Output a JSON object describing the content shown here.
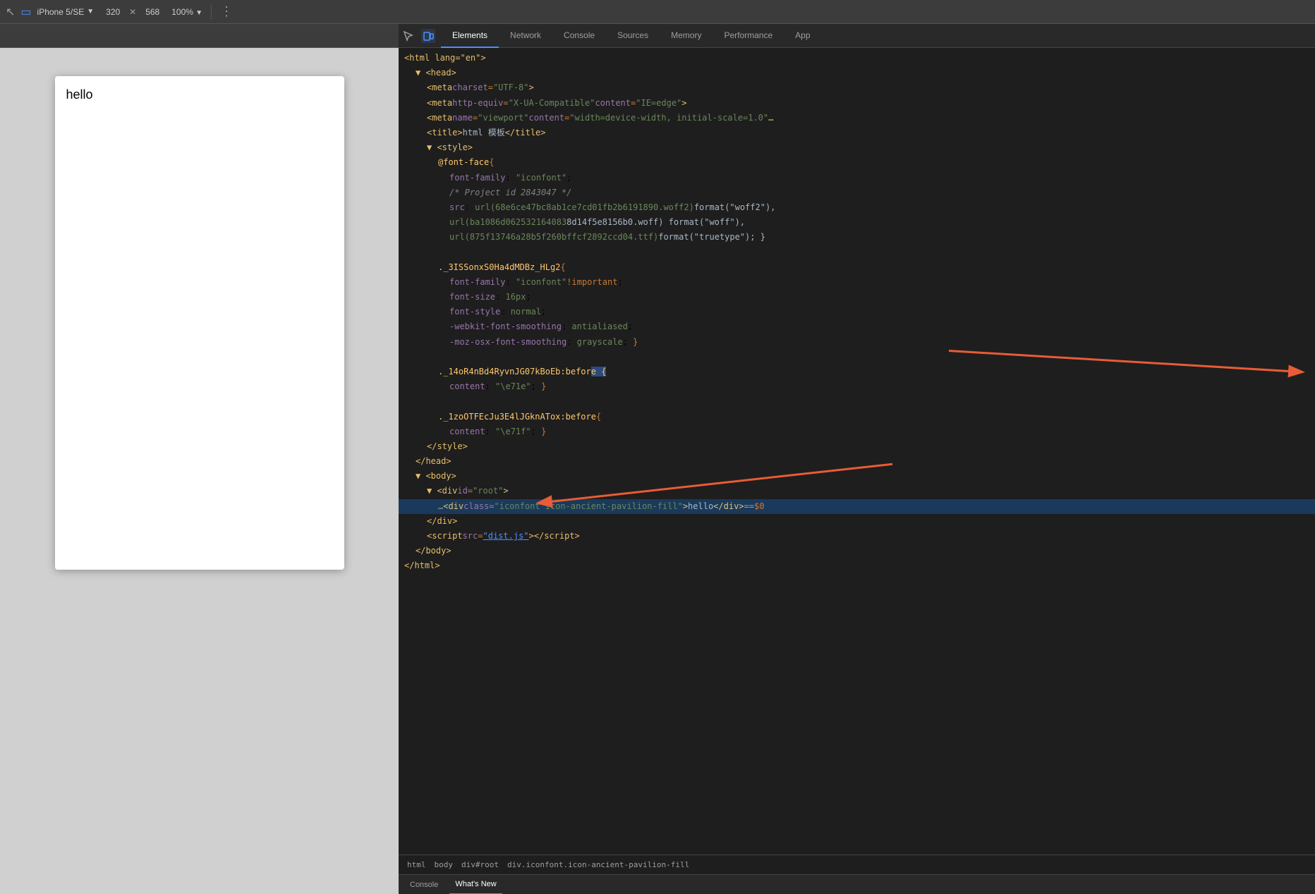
{
  "toolbar": {
    "device_label": "iPhone 5/SE",
    "width": "320",
    "close_symbol": "✕",
    "height": "568",
    "zoom": "100%",
    "more_icon": "⋮",
    "cursor_icon": "↖",
    "device_icon": "▭"
  },
  "preview": {
    "hello_text": "hello"
  },
  "devtools": {
    "tabs": [
      {
        "id": "elements",
        "label": "Elements",
        "active": true
      },
      {
        "id": "network",
        "label": "Network",
        "active": false
      },
      {
        "id": "console",
        "label": "Console",
        "active": false
      },
      {
        "id": "sources",
        "label": "Sources",
        "active": false
      },
      {
        "id": "memory",
        "label": "Memory",
        "active": false
      },
      {
        "id": "performance",
        "label": "Performance",
        "active": false
      },
      {
        "id": "app",
        "label": "App",
        "active": false
      }
    ],
    "breadcrumb": [
      "html",
      "body",
      "div#root",
      "div.iconfont.icon-ancient-pavilion-fill"
    ]
  },
  "code": {
    "lines": [
      {
        "indent": 0,
        "triangle": "open",
        "html": "<span class='tag'>&lt;html lang=\"en\"&gt;</span>"
      },
      {
        "indent": 1,
        "triangle": "open",
        "html": "<span class='tag'>▼ &lt;head&gt;</span>"
      },
      {
        "indent": 2,
        "triangle": "empty",
        "html": "<span class='tag'>&lt;meta</span> <span class='attr-name'>charset</span><span class='punctuation'>=</span><span class='attr-value'>\"UTF-8\"</span><span class='tag'>&gt;</span>"
      },
      {
        "indent": 2,
        "triangle": "empty",
        "html": "<span class='tag'>&lt;meta</span> <span class='attr-name'>http-equiv</span><span class='punctuation'>=</span><span class='attr-value'>\"X-UA-Compatible\"</span> <span class='attr-name'>content</span><span class='punctuation'>=</span><span class='attr-value'>\"IE=edge\"</span><span class='tag'>&gt;</span>"
      },
      {
        "indent": 2,
        "triangle": "empty",
        "html": "<span class='tag'>&lt;meta</span> <span class='attr-name'>name</span><span class='punctuation'>=</span><span class='attr-value'>\"viewport\"</span> <span class='attr-name'>content</span><span class='punctuation'>=</span><span class='attr-value'>\"width=device-width, initial-scale=1.0\"</span><span class='tag'>…</span>"
      },
      {
        "indent": 2,
        "triangle": "empty",
        "html": "<span class='tag'>&lt;title&gt;</span><span class='text-content'>html 模板</span><span class='tag'>&lt;/title&gt;</span>"
      },
      {
        "indent": 2,
        "triangle": "open",
        "html": "<span class='tag'>▼ &lt;style&gt;</span>"
      },
      {
        "indent": 3,
        "triangle": "empty",
        "html": "<span class='selector'>@font-face</span> <span class='punctuation'>{</span>"
      },
      {
        "indent": 4,
        "triangle": "empty",
        "html": "<span class='property'>font-family</span>: <span class='attr-value'>\"iconfont\"</span>;"
      },
      {
        "indent": 4,
        "triangle": "empty",
        "html": "<span class='comment'>/* Project id 2843047 */</span>"
      },
      {
        "indent": 4,
        "triangle": "empty",
        "html": "<span class='property'>src</span>: <span class='attr-value'>url(68e6ce47bc8ab1ce7cd01fb2b6191890.woff2)</span> <span class='text-content'>format(\"woff2\"),</span>"
      },
      {
        "indent": 4,
        "triangle": "empty",
        "html": "<span class='attr-value'>url(ba1086d062532164083</span><span class='text-content'>8d14f5e8156b0.woff) format(\"woff\"),</span>"
      },
      {
        "indent": 4,
        "triangle": "empty",
        "html": "<span class='attr-value'>url(875f13746a28b5f260bffcf2892ccd04.ttf)</span> <span class='text-content'>format(\"truetype\"); }</span>"
      },
      {
        "indent": 3,
        "triangle": "empty",
        "html": ""
      },
      {
        "indent": 3,
        "triangle": "empty",
        "html": "<span class='selector'>._3ISSonxS0Ha4dMDBz_HLg2</span> <span class='punctuation'>{</span>"
      },
      {
        "indent": 4,
        "triangle": "empty",
        "html": "<span class='property'>font-family</span>: <span class='attr-value'>\"iconfont\"</span> <span class='important'>!important</span>;"
      },
      {
        "indent": 4,
        "triangle": "empty",
        "html": "<span class='property'>font-size</span>: <span class='value'>16px</span>;"
      },
      {
        "indent": 4,
        "triangle": "empty",
        "html": "<span class='property'>font-style</span>: <span class='value'>normal</span>;"
      },
      {
        "indent": 4,
        "triangle": "empty",
        "html": "<span class='property'>-webkit-font-smoothing</span>: <span class='value'>antialiased</span>;"
      },
      {
        "indent": 4,
        "triangle": "empty",
        "html": "<span class='property'>-moz-osx-font-smoothing</span>: <span class='value'>grayscale</span>; <span class='punctuation'>}</span>"
      },
      {
        "indent": 3,
        "triangle": "empty",
        "html": ""
      },
      {
        "indent": 3,
        "triangle": "empty",
        "html": "<span class='selector'>._14oR4nBd4RyvnJG07kBoEb:befor<span style='background:#2d4a7a'>e {</span></span>"
      },
      {
        "indent": 4,
        "triangle": "empty",
        "html": "<span class='property'>content</span>: <span class='attr-value'>\"\\e71e\"</span>; <span class='punctuation'>}</span>"
      },
      {
        "indent": 3,
        "triangle": "empty",
        "html": ""
      },
      {
        "indent": 3,
        "triangle": "empty",
        "html": "<span class='selector'>._1zoOTFEcJu3E4lJGknATox:before</span> <span class='punctuation'>{</span>"
      },
      {
        "indent": 4,
        "triangle": "empty",
        "html": "<span class='property'>content</span>: <span class='attr-value'>\"\\e71f\"</span>; <span class='punctuation'>}</span>"
      },
      {
        "indent": 2,
        "triangle": "empty",
        "html": "<span class='tag'>&lt;/style&gt;</span>"
      },
      {
        "indent": 1,
        "triangle": "empty",
        "html": "<span class='tag'>&lt;/head&gt;</span>"
      },
      {
        "indent": 1,
        "triangle": "open",
        "html": "<span class='tag'>▼ &lt;body&gt;</span>"
      },
      {
        "indent": 2,
        "triangle": "open",
        "html": "<span class='tag'>▼ &lt;div</span> <span class='attr-name'>id</span><span class='punctuation'>=</span><span class='attr-value'>\"root\"</span><span class='tag'>&gt;</span>"
      },
      {
        "indent": 3,
        "triangle": "empty",
        "html": "<span class='dots'>…</span>  <span class='tag'>&lt;div</span> <span class='attr-name'>class</span><span class='punctuation'>=</span><span class='attr-value'>\"iconfont icon-ancient-pavilion-fill\"</span><span class='tag'>&gt;</span><span class='text-content'>hello</span><span class='tag'>&lt;/div&gt;</span> <span class='eq'>==</span> <span class='dollar'>$0</span>",
        "selected": true
      },
      {
        "indent": 2,
        "triangle": "empty",
        "html": "<span class='tag'>&lt;/div&gt;</span>"
      },
      {
        "indent": 2,
        "triangle": "empty",
        "html": "<span class='tag'>&lt;script</span> <span class='attr-name'>src</span><span class='punctuation'>=</span><span class='attr-value' style='text-decoration:underline;color:#4d90fe'>\"dist.js\"</span><span class='tag'>&gt;&lt;/script&gt;</span>"
      },
      {
        "indent": 1,
        "triangle": "empty",
        "html": "<span class='tag'>&lt;/body&gt;</span>"
      },
      {
        "indent": 0,
        "triangle": "empty",
        "html": "<span class='tag'>&lt;/html&gt;</span>"
      }
    ]
  },
  "console_bar": {
    "items": [
      "Console",
      "What's New"
    ]
  }
}
